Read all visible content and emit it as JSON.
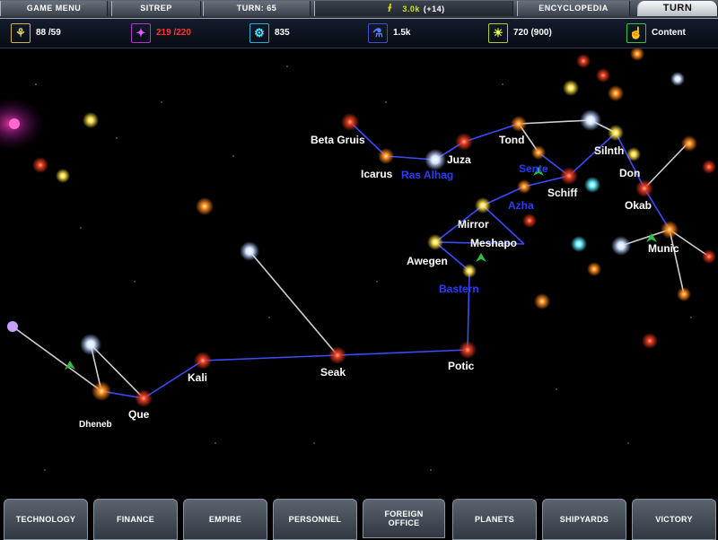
{
  "topbar": {
    "game_menu": "GAME MENU",
    "sitrep": "SITREP",
    "turn_number": "TURN: 65",
    "ap_value": "3.0k",
    "ap_delta": "(+14)",
    "encyclopedia": "ENCYCLOPEDIA",
    "turn_button": "TURN"
  },
  "resources": [
    {
      "icon": "wheat-icon",
      "value": "88 /59",
      "color": "#ffffff"
    },
    {
      "icon": "crystal-icon",
      "value": "219 /220",
      "color": "#ff3636"
    },
    {
      "icon": "gear-icon",
      "value": "835",
      "color": "#ffffff"
    },
    {
      "icon": "research-icon",
      "value": "1.5k",
      "color": "#ffffff"
    },
    {
      "icon": "lightbulb-icon",
      "value": "720 (900)",
      "color": "#ffffff"
    },
    {
      "icon": "thumbs-up-icon",
      "value": "Content",
      "color": "#ffffff"
    }
  ],
  "systems": {
    "beta_gruis": "Beta Gruis",
    "juza": "Juza",
    "icarus": "Icarus",
    "ras_alhag": "Ras Alhag",
    "tond": "Tond",
    "silnth": "Silnth",
    "sente": "Sente",
    "don": "Don",
    "schiff": "Schiff",
    "azha": "Azha",
    "okab": "Okab",
    "mirror": "Mirror",
    "meshapo": "Meshapo",
    "awegen": "Awegen",
    "munic": "Munic",
    "bastern": "Bastern",
    "potic": "Potic",
    "seak": "Seak",
    "kali": "Kali",
    "que": "Que",
    "dheneb": "Dheneb"
  },
  "tabs": {
    "technology": "TECHNOLOGY",
    "finance": "FINANCE",
    "empire": "EMPIRE",
    "personnel": "PERSONNEL",
    "foreign_office": "FOREIGN OFFICE",
    "planets": "PLANETS",
    "shipyards": "SHIPYARDS",
    "victory": "VICTORY"
  },
  "colors": {
    "supply_lane": "#3a4cff",
    "other_lane": "#d8d8d8",
    "label_blue": "#2c3cff",
    "deficit_red": "#ff3636"
  }
}
